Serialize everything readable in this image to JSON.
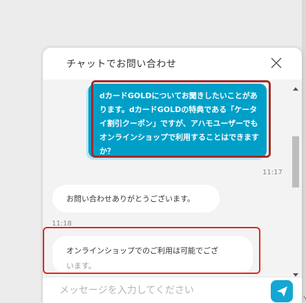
{
  "chat": {
    "title": "チャットでお問い合わせ",
    "close_icon": "close-icon"
  },
  "messages": [
    {
      "sender": "user",
      "text": "dカードGOLDについてお聞きしたいことがあります。dカードGOLDの特典である「ケータイ割引クーポン」ですが、アハモユーザーでもオンラインショップで利用することはできますか？",
      "time": "11:17"
    },
    {
      "sender": "bot",
      "text": "お問い合わせありがとうございます。",
      "time": "11:18"
    },
    {
      "sender": "bot",
      "text_main": "オンラインショップでのご利用は可能でござ",
      "text_faded": "います。"
    }
  ],
  "input": {
    "placeholder": "メッセージを入力してください"
  },
  "send_icon": "paper-plane-icon",
  "colors": {
    "accent": "#009fc8",
    "send_button": "#14a6d4",
    "highlight_red": "#e0261b",
    "highlight_dark_red": "#a52a2a"
  }
}
